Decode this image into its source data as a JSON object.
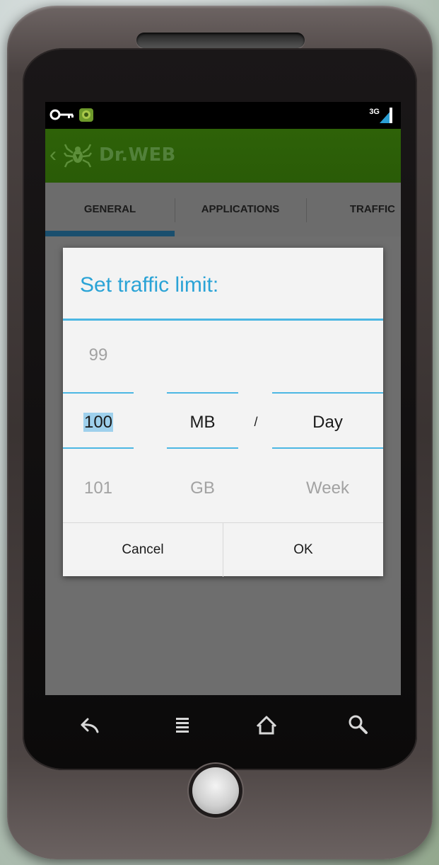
{
  "app": {
    "title": "Dr.WEB"
  },
  "status": {
    "network": "3G"
  },
  "tabs": [
    {
      "label": "GENERAL",
      "selected": true
    },
    {
      "label": "APPLICATIONS",
      "selected": false
    },
    {
      "label": "TRAFFIC",
      "selected": false
    }
  ],
  "dialog": {
    "title": "Set traffic limit:",
    "amount": {
      "prev": "99",
      "current": "100",
      "next": "101"
    },
    "unit": {
      "prev": "",
      "current": "MB",
      "next": "GB"
    },
    "separator": "/",
    "period": {
      "prev": "",
      "current": "Day",
      "next": "Week"
    },
    "cancel_label": "Cancel",
    "ok_label": "OK"
  },
  "colors": {
    "accent": "#2aa3d6",
    "actionbar": "#2e6208",
    "tab_indicator": "#1a4f6e"
  },
  "navbar": {
    "icons": [
      "back-icon",
      "menu-icon",
      "home-icon",
      "search-icon"
    ]
  }
}
